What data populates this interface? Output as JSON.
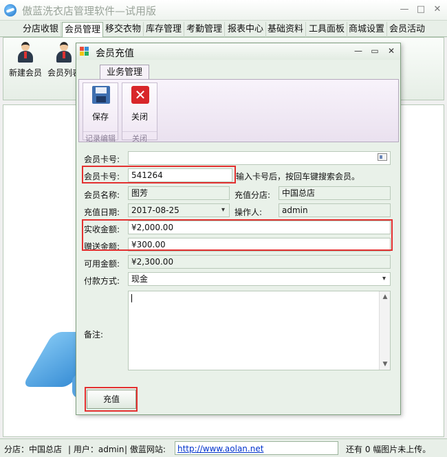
{
  "app": {
    "title": "傲蓝洗衣店管理软件—试用版"
  },
  "menu": {
    "tabs": [
      {
        "label": "分店收银",
        "active": false
      },
      {
        "label": "会员管理",
        "active": true
      },
      {
        "label": "移交衣物",
        "active": false
      },
      {
        "label": "库存管理",
        "active": false
      },
      {
        "label": "考勤管理",
        "active": false
      },
      {
        "label": "报表中心",
        "active": false
      },
      {
        "label": "基础资料",
        "active": false
      },
      {
        "label": "工具面板",
        "active": false
      },
      {
        "label": "商城设置",
        "active": false
      },
      {
        "label": "会员活动",
        "active": false
      }
    ]
  },
  "ribbon": {
    "new_member": "新建会员",
    "member_list": "会员列表"
  },
  "dialog": {
    "title": "会员充值",
    "tab": "业务管理",
    "save_label": "保存",
    "close_label": "关闭",
    "group_record": "记录编辑",
    "group_close": "关闭",
    "form": {
      "card_search_label": "会员卡号:",
      "card_search_value": "",
      "card_label": "会员卡号:",
      "card_value": "541264",
      "hint": "输入卡号后，按回车键搜索会员。",
      "name_label": "会员名称:",
      "name_value": "图芳",
      "branch_label": "充值分店:",
      "branch_value": "中国总店",
      "date_label": "充值日期:",
      "date_value": "2017-08-25",
      "operator_label": "操作人:",
      "operator_value": "admin",
      "received_label": "实收金额:",
      "received_value": "¥2,000.00",
      "bonus_label": "赠送金额:",
      "bonus_value": "¥300.00",
      "available_label": "可用金额:",
      "available_value": "¥2,300.00",
      "payment_label": "付款方式:",
      "payment_value": "现金",
      "remark_label": "备注:",
      "remark_value": ""
    },
    "charge_label": "充值"
  },
  "status": {
    "branch": "分店：中国总店",
    "user": "| 用户：admin",
    "site_label": "| 傲蓝网站:",
    "url": "http://www.aolan.net",
    "upload": "还有 0 幅图片未上传。"
  }
}
